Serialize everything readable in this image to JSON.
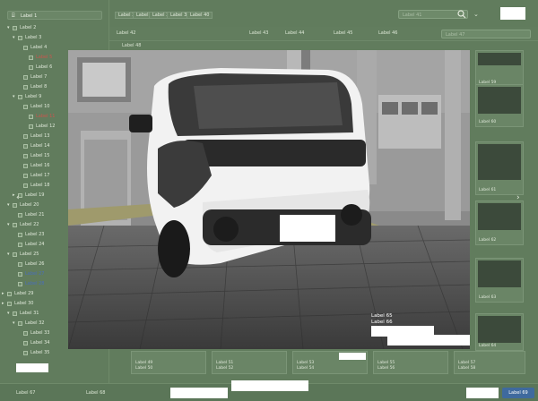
{
  "sidebar": {
    "header": "Label 1",
    "items": [
      {
        "label": "Label 2",
        "indent": 8,
        "style": "normal",
        "arrow": "▾"
      },
      {
        "label": "Label 3",
        "indent": 14,
        "style": "normal",
        "arrow": "▾"
      },
      {
        "label": "Label 4",
        "indent": 20,
        "style": "normal",
        "arrow": ""
      },
      {
        "label": "Label 5",
        "indent": 26,
        "style": "red",
        "arrow": ""
      },
      {
        "label": "Label 6",
        "indent": 26,
        "style": "normal",
        "arrow": ""
      },
      {
        "label": "Label 7",
        "indent": 20,
        "style": "normal",
        "arrow": ""
      },
      {
        "label": "Label 8",
        "indent": 20,
        "style": "normal",
        "arrow": ""
      },
      {
        "label": "Label 9",
        "indent": 14,
        "style": "normal",
        "arrow": "▾"
      },
      {
        "label": "Label 10",
        "indent": 20,
        "style": "normal",
        "arrow": ""
      },
      {
        "label": "Label 11",
        "indent": 26,
        "style": "red",
        "arrow": ""
      },
      {
        "label": "Label 12",
        "indent": 26,
        "style": "normal",
        "arrow": ""
      },
      {
        "label": "Label 13",
        "indent": 20,
        "style": "normal",
        "arrow": ""
      },
      {
        "label": "Label 14",
        "indent": 20,
        "style": "normal",
        "arrow": ""
      },
      {
        "label": "Label 15",
        "indent": 20,
        "style": "normal",
        "arrow": ""
      },
      {
        "label": "Label 16",
        "indent": 20,
        "style": "normal",
        "arrow": ""
      },
      {
        "label": "Label 17",
        "indent": 20,
        "style": "normal",
        "arrow": ""
      },
      {
        "label": "Label 18",
        "indent": 20,
        "style": "normal",
        "arrow": ""
      },
      {
        "label": "Label 19",
        "indent": 14,
        "style": "normal",
        "arrow": "▸"
      },
      {
        "label": "Label 20",
        "indent": 8,
        "style": "normal",
        "arrow": "▾"
      },
      {
        "label": "Label 21",
        "indent": 14,
        "style": "normal",
        "arrow": ""
      },
      {
        "label": "Label 22",
        "indent": 8,
        "style": "normal",
        "arrow": "▾"
      },
      {
        "label": "Label 23",
        "indent": 14,
        "style": "normal",
        "arrow": ""
      },
      {
        "label": "Label 24",
        "indent": 14,
        "style": "normal",
        "arrow": ""
      },
      {
        "label": "Label 25",
        "indent": 8,
        "style": "normal",
        "arrow": "▾"
      },
      {
        "label": "Label 26",
        "indent": 14,
        "style": "normal",
        "arrow": ""
      },
      {
        "label": "Label 27",
        "indent": 14,
        "style": "blue",
        "arrow": ""
      },
      {
        "label": "Label 28",
        "indent": 14,
        "style": "blue",
        "arrow": ""
      },
      {
        "label": "Label 29",
        "indent": 2,
        "style": "normal",
        "arrow": "▸"
      },
      {
        "label": "Label 30",
        "indent": 2,
        "style": "normal",
        "arrow": "▸"
      },
      {
        "label": "Label 31",
        "indent": 8,
        "style": "normal",
        "arrow": "▾"
      },
      {
        "label": "Label 32",
        "indent": 14,
        "style": "normal",
        "arrow": "▾"
      },
      {
        "label": "Label 33",
        "indent": 20,
        "style": "normal",
        "arrow": ""
      },
      {
        "label": "Label 34",
        "indent": 20,
        "style": "normal",
        "arrow": ""
      },
      {
        "label": "Label 35",
        "indent": 20,
        "style": "normal",
        "arrow": ""
      }
    ]
  },
  "toolbar": {
    "buttons": [
      "Label 36",
      "Label 37",
      "Label 38",
      "Label 39",
      "Label 40"
    ],
    "search_placeholder": "Label 41"
  },
  "subbar": {
    "items": [
      "Label 42",
      "Label 43",
      "Label 44",
      "Label 45",
      "Label 46"
    ],
    "search_placeholder": "Label 47"
  },
  "breadcrumb": "Label 48",
  "cards_bottom": [
    {
      "caption": "Label 49",
      "sub": "Label 50"
    },
    {
      "caption": "Label 51",
      "sub": "Label 52"
    },
    {
      "caption": "Label 53",
      "sub": "Label 54"
    },
    {
      "caption": "Label 55",
      "sub": "Label 56"
    },
    {
      "caption": "Label 57",
      "sub": "Label 58"
    }
  ],
  "right_thumbs": [
    {
      "label": "Label 59"
    },
    {
      "label": "Label 60"
    },
    {
      "label": "Label 61"
    },
    {
      "label": "Label 62"
    },
    {
      "label": "Label 63"
    },
    {
      "label": "Label 64"
    }
  ],
  "viewer": {
    "stamp_line1": "Label 65",
    "stamp_line2": "Label 66"
  },
  "footer": {
    "left_label": "Label 67",
    "mid_label": "Label 68",
    "button": "Label 69"
  }
}
